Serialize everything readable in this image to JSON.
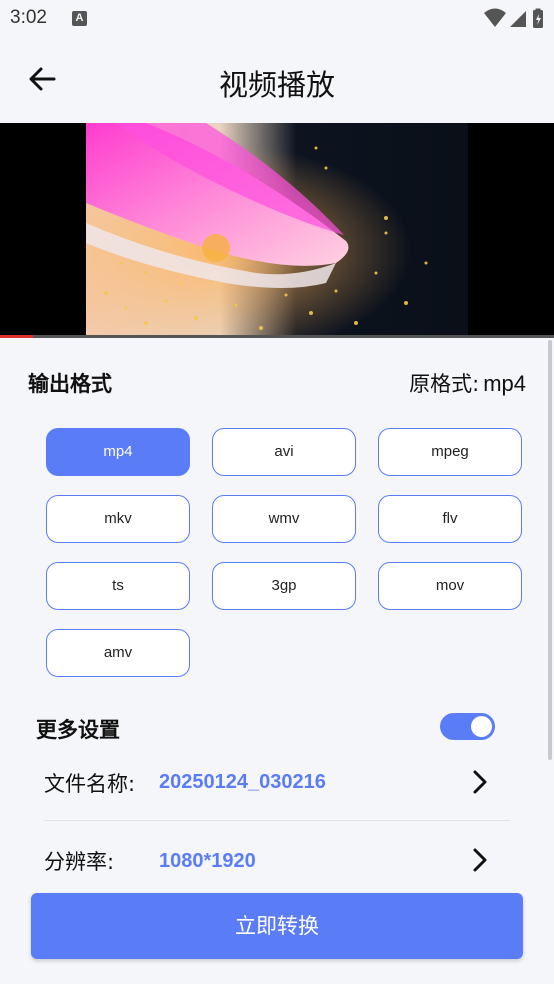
{
  "status_bar": {
    "time": "3:02",
    "notification_icon": "A"
  },
  "header": {
    "title": "视频播放",
    "back_icon": "arrow-left-icon"
  },
  "video": {
    "progress": 0.06,
    "progress_color": "#e0302b"
  },
  "output": {
    "title": "输出格式",
    "original_label": "原格式:",
    "original_value": "mp4",
    "formats": [
      "mp4",
      "avi",
      "mpeg",
      "mkv",
      "wmv",
      "flv",
      "ts",
      "3gp",
      "mov",
      "amv"
    ],
    "selected": "mp4"
  },
  "more_settings": {
    "title": "更多设置",
    "toggle_on": true,
    "file_name_label": "文件名称:",
    "file_name_value": "20250124_030216",
    "resolution_label": "分辨率:",
    "resolution_value": "1080*1920"
  },
  "convert_button": "立即转换",
  "colors": {
    "accent": "#5b7cf7",
    "background": "#f5f6fa"
  }
}
